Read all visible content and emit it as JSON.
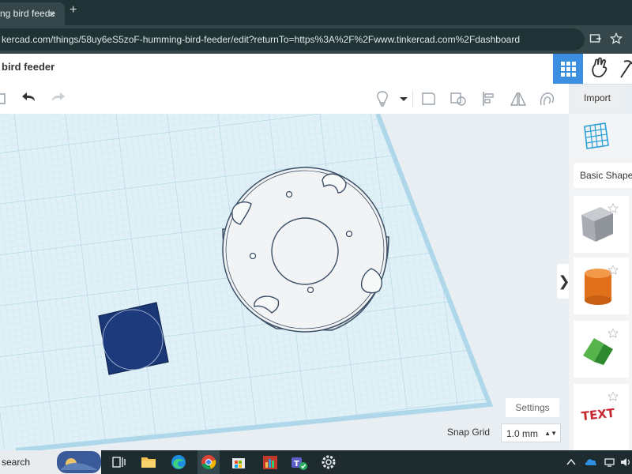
{
  "browser": {
    "tab_title": "ng bird feede",
    "close_tab": "×",
    "new_tab": "+",
    "url": "kercad.com/things/58uy6eS5zoF-humming-bird-feeder/edit?returnTo=https%3A%2F%2Fwww.tinkercad.com%2Fdashboard"
  },
  "header": {
    "title": "bird feeder"
  },
  "toolbar": {
    "import_label": "Import"
  },
  "side_panel": {
    "category_label": "Basic Shape",
    "shapes": [
      {
        "name": "box",
        "color": "#a9adb3"
      },
      {
        "name": "cylinder",
        "color": "#e8761b"
      },
      {
        "name": "roof",
        "color": "#3b9a3b"
      },
      {
        "name": "text",
        "color": "#c9252f",
        "text": "TEXT"
      }
    ]
  },
  "workplane": {
    "settings_label": "Settings",
    "snap_grid_label": "Snap Grid",
    "snap_grid_value": "1.0 mm",
    "collapse_glyph": "❯"
  },
  "taskbar": {
    "search_label": "search"
  }
}
